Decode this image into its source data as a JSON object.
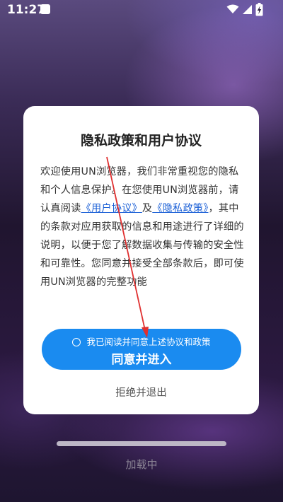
{
  "status_bar": {
    "time": "11:27"
  },
  "dialog": {
    "title": "隐私政策和用户协议",
    "body_intro": "欢迎使用UN浏览器，我们非常重视您的隐私和个人信息保护。在您使用UN浏览器前，请认真阅读",
    "user_agreement_link": "《用户协议》",
    "and_text": "及",
    "privacy_policy_link": "《隐私政策》",
    "body_rest": "，其中的条款对应用获取的信息和用途进行了详细的说明，以便于您了解数据收集与传输的安全性和可靠性。您同意并接受全部条款后，即可使用UN浏览器的完整功能",
    "consent_text": "我已阅读并同意上述协议和政策",
    "agree_button_label": "同意并进入",
    "reject_label": "拒绝并退出"
  },
  "loading": {
    "label": "加载中"
  },
  "colors": {
    "accent": "#1a8bf0",
    "link": "#1a5fd6",
    "annotation_arrow": "#e03030"
  }
}
